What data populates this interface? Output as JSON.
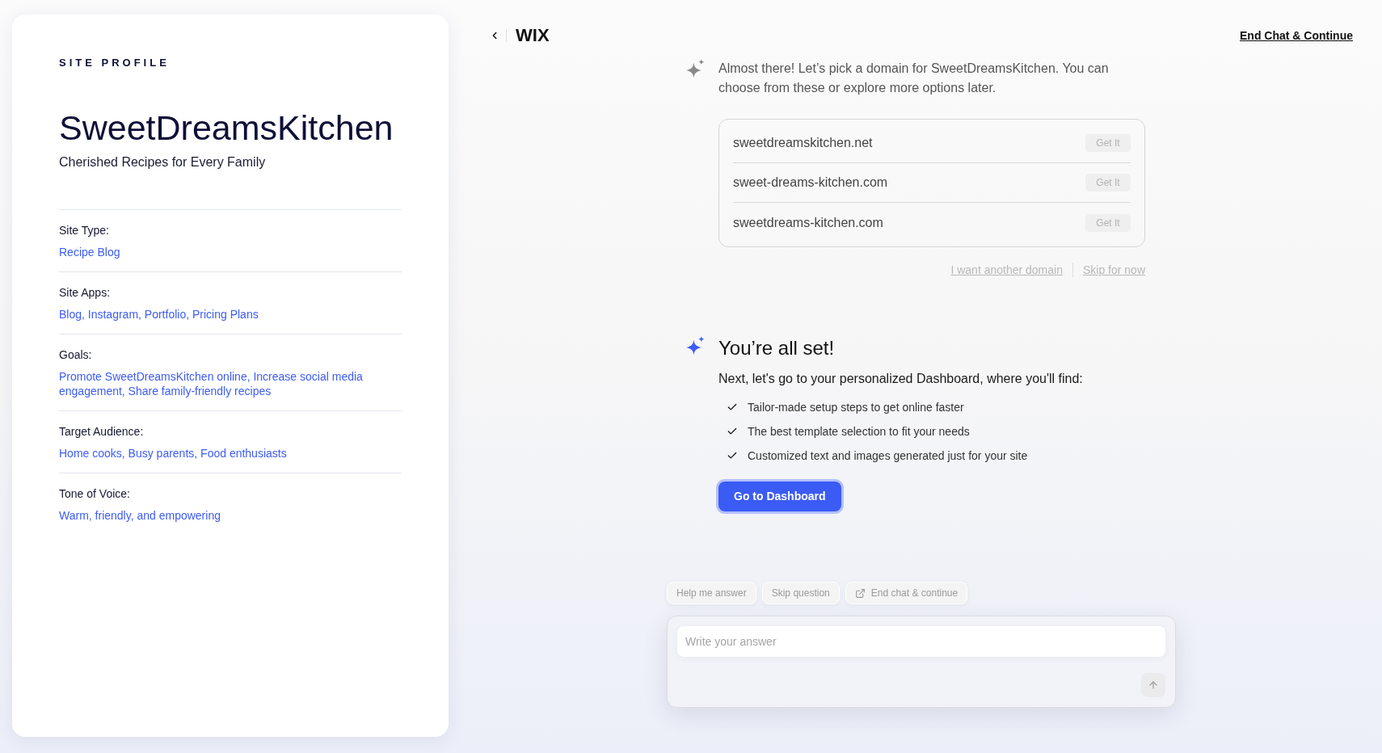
{
  "site_profile": {
    "heading": "SITE PROFILE",
    "site_name": "SweetDreamsKitchen",
    "tagline": "Cherished Recipes for Every Family",
    "fields": [
      {
        "label": "Site Type:",
        "value": "Recipe Blog"
      },
      {
        "label": "Site Apps:",
        "value": "Blog, Instagram, Portfolio, Pricing Plans"
      },
      {
        "label": "Goals:",
        "value": "Promote SweetDreamsKitchen online, Increase social media engagement, Share family-friendly recipes"
      },
      {
        "label": "Target Audience:",
        "value": "Home cooks, Busy parents, Food enthusiasts"
      },
      {
        "label": "Tone of Voice:",
        "value": "Warm, friendly, and empowering"
      }
    ]
  },
  "header": {
    "logo": "WIX",
    "end_chat_link": "End Chat & Continue"
  },
  "domain_message": {
    "text": "Almost there! Let’s pick a domain for SweetDreamsKitchen. You can choose from these or explore more options later.",
    "domains": [
      {
        "name": "sweetdreamskitchen.net",
        "button": "Get It",
        "disabled": true
      },
      {
        "name": "sweet-dreams-kitchen.com",
        "button": "Get It",
        "disabled": true
      },
      {
        "name": "sweetdreams-kitchen.com",
        "button": "Get It",
        "disabled": true
      }
    ],
    "links": [
      {
        "label": "I want another domain",
        "disabled": true
      },
      {
        "label": "Skip for now",
        "disabled": true
      }
    ]
  },
  "completion_message": {
    "title": "You’re all set!",
    "intro": "Next, let's go to your personalized Dashboard, where you'll find:",
    "items": [
      "Tailor-made setup steps to get online faster",
      "The best template selection to fit your needs",
      "Customized text and images generated just for your site"
    ],
    "button": "Go to Dashboard"
  },
  "composer": {
    "suggestions": [
      {
        "kind": "plain",
        "label": "Help me answer"
      },
      {
        "kind": "plain",
        "label": "Skip question"
      },
      {
        "kind": "exit",
        "label": "End chat & continue"
      }
    ],
    "input": {
      "placeholder": "Write your answer"
    }
  }
}
